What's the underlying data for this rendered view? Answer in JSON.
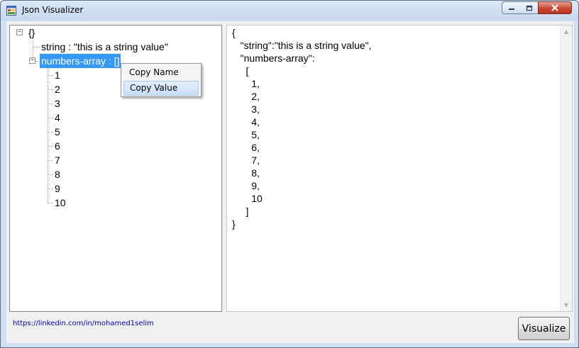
{
  "window": {
    "title": "Json Visualizer",
    "icon": "app-window-icon",
    "controls": {
      "minimize": "minimize-icon",
      "maximize": "maximize-icon",
      "close": "close-icon"
    }
  },
  "tree": {
    "root_label": "{}",
    "nodes": [
      {
        "label": "string : \"this is a string value\""
      },
      {
        "label": "numbers-array : []",
        "selected": true
      }
    ],
    "array_items": [
      "1",
      "2",
      "3",
      "4",
      "5",
      "6",
      "7",
      "8",
      "9",
      "10"
    ]
  },
  "context_menu": {
    "items": [
      {
        "label": "Copy Name"
      },
      {
        "label": "Copy Value",
        "highlighted": true
      }
    ]
  },
  "json_view": {
    "text": "{\n   \"string\":\"this is a string value\",\n   \"numbers-array\":\n     [\n       1,\n       2,\n       3,\n       4,\n       5,\n       6,\n       7,\n       8,\n       9,\n       10\n     ]\n}"
  },
  "footer": {
    "link_text": "https://linkedin.com/in/mohamed1selim",
    "button_label": "Visualize"
  },
  "colors": {
    "selection": "#3399ff",
    "menu_highlight": "#c9ddf7",
    "link": "#0000cc",
    "close_button": "#c74a33"
  }
}
